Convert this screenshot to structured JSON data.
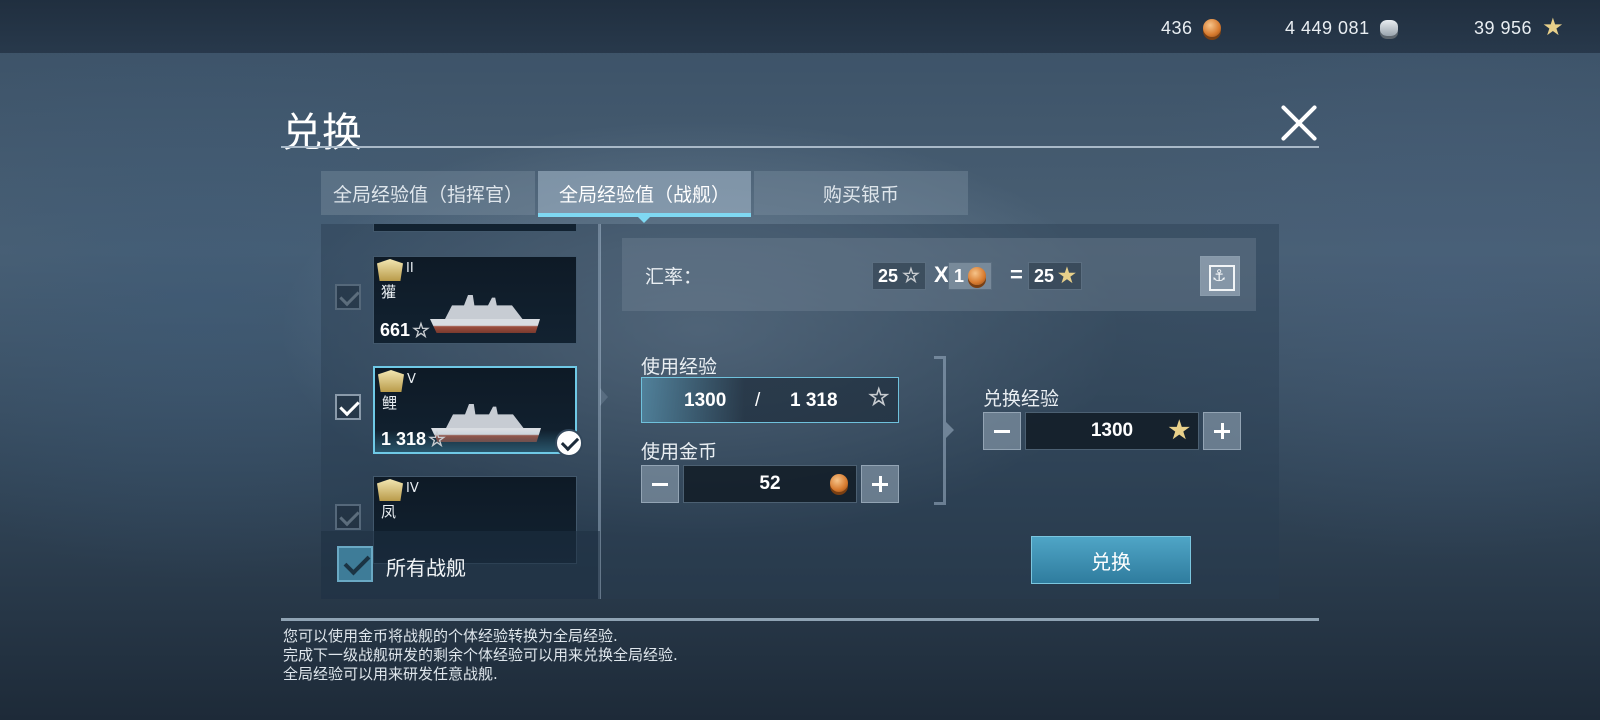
{
  "resources": [
    {
      "value": "436",
      "icon": "gold-coin-icon"
    },
    {
      "value": "4 449 081",
      "icon": "silver-coin-icon"
    },
    {
      "value": "39 956",
      "icon": "free-exp-star-icon"
    }
  ],
  "title": "兑换",
  "tabs": [
    {
      "label": "全局经验值（指挥官）",
      "active": false
    },
    {
      "label": "全局经验值（战舰）",
      "active": true
    },
    {
      "label": "购买银币",
      "active": false
    }
  ],
  "ships": [
    {
      "tier": "II",
      "name": "獾",
      "exp": "661",
      "checked": false
    },
    {
      "tier": "V",
      "name": "鲤",
      "exp": "1 318",
      "checked": true
    },
    {
      "tier": "IV",
      "name": "凤",
      "exp": "",
      "checked": false
    }
  ],
  "all_ships_label": "所有战舰",
  "rate": {
    "label": "汇率：",
    "exp_amount": "25",
    "multiplier": "X",
    "gold_amount": "1",
    "equals": "=",
    "result": "25"
  },
  "use_exp": {
    "label": "使用经验",
    "value": "1300",
    "separator": "/",
    "max": "1 318"
  },
  "use_gold": {
    "label": "使用金币",
    "value": "52"
  },
  "convert_exp": {
    "label": "兑换经验",
    "value": "1300"
  },
  "exchange_button": "兑换",
  "description": [
    "您可以使用金币将战舰的个体经验转换为全局经验.",
    "完成下一级战舰研发的剩余个体经验可以用来兑换全局经验.",
    "全局经验可以用来研发任意战舰."
  ],
  "colors": {
    "accent": "#7fd8f2",
    "button": "#3a8cb0"
  }
}
